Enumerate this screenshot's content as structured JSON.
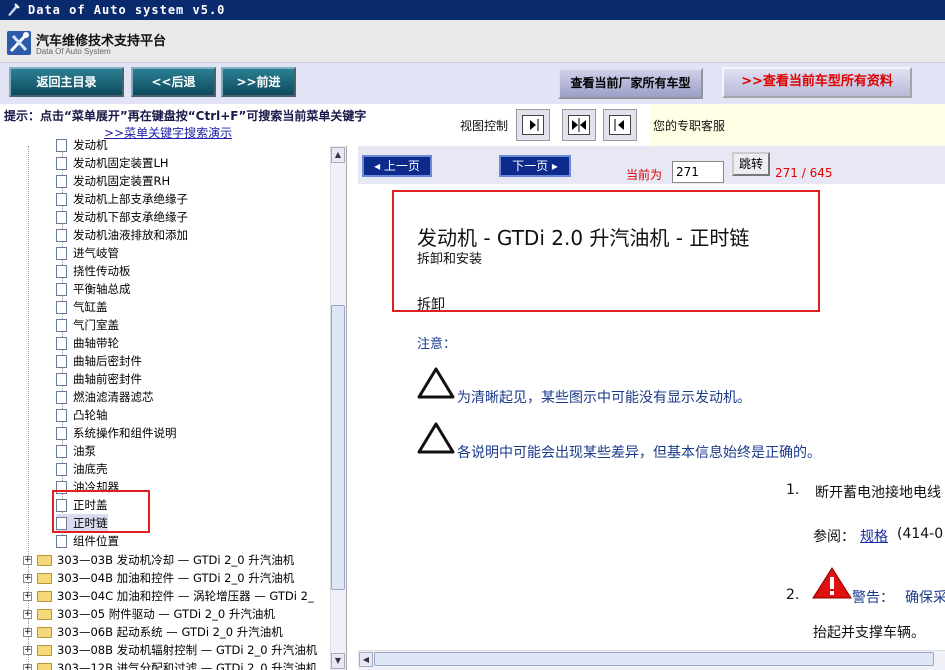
{
  "window": {
    "title": "Data of Auto system v5.0"
  },
  "brand": {
    "title": "汽车维修技术支持平台",
    "subtitle": "Data Of Auto System"
  },
  "toolbar": {
    "home_label": "返回主目录",
    "back_label": "<<后退",
    "forward_label": ">>前进",
    "vendor_models_label": "查看当前厂家所有车型",
    "all_info_label": ">>查看当前车型所有资料"
  },
  "hint": {
    "text": "提示：点击“菜单展开”再在键盘按“Ctrl+F”可搜索当前菜单关键字",
    "link": ">>菜单关键字搜索演示"
  },
  "view_control": {
    "label": "视图控制"
  },
  "agent": {
    "text": "您的专职客服"
  },
  "tree": {
    "items": [
      "发动机",
      "发动机固定装置LH",
      "发动机固定装置RH",
      "发动机上部支承绝缘子",
      "发动机下部支承绝缘子",
      "发动机油液排放和添加",
      "进气岐管",
      "挠性传动板",
      "平衡轴总成",
      "气缸盖",
      "气门室盖",
      "曲轴带轮",
      "曲轴后密封件",
      "曲轴前密封件",
      "燃油滤清器滤芯",
      "凸轮轴",
      "系统操作和组件说明",
      "油泵",
      "油底壳",
      "油冷却器",
      "正时盖",
      "正时链",
      "组件位置"
    ],
    "folders": [
      "303—03B 发动机冷却 — GTDi 2_0 升汽油机",
      "303—04B 加油和控件 — GTDi 2_0 升汽油机",
      "303—04C 加油和控件 — 涡轮增压器 — GTDi 2_",
      "303—05 附件驱动 — GTDi 2_0 升汽油机",
      "303—06B 起动系统 — GTDi 2_0 升汽油机",
      "303—08B 发动机辐射控制 — GTDi 2_0 升汽油机",
      "303—12B 进气分配和过滤 — GTDi 2_0 升汽油机"
    ]
  },
  "nav": {
    "prev_label": "上一页",
    "next_label": "下一页",
    "current_label": "当前为",
    "page_value": "271",
    "jump_label": "跳转",
    "page_count": "271 / 645"
  },
  "document": {
    "title": "发动机 - GTDi 2.0 升汽油机 - 正时链",
    "subtitle": "拆卸和安装",
    "section": "拆卸",
    "note_label": "注意：",
    "notes": [
      "为清晰起见，某些图示中可能没有显示发动机。",
      "各说明中可能会出现某些差异，但基本信息始终是正确的。"
    ],
    "step1_num": "1.",
    "step1_text": "断开蓄电池接地电线",
    "ref_label": "参阅：",
    "ref_link": "规格",
    "ref_code": "(414-0",
    "step2_num": "2.",
    "warning_label": "警告：",
    "warning_text": "确保采",
    "step2_cont": "抬起并支撑车辆。"
  },
  "colors": {
    "accent_red": "#e02020",
    "title_bar": "#0a2a6e",
    "nav_button": "#0b2a8c"
  }
}
